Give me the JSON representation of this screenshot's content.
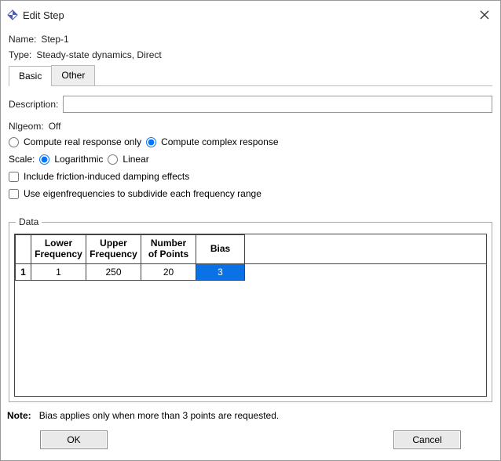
{
  "window": {
    "title": "Edit Step"
  },
  "name": {
    "label": "Name:",
    "value": "Step-1"
  },
  "type": {
    "label": "Type:",
    "value": "Steady-state dynamics, Direct"
  },
  "tabs": {
    "basic": "Basic",
    "other": "Other"
  },
  "description": {
    "label": "Description:",
    "value": ""
  },
  "nlgeom": {
    "label": "Nlgeom:",
    "value": "Off"
  },
  "response": {
    "real": "Compute real response only",
    "complex": "Compute complex response"
  },
  "scale": {
    "label": "Scale:",
    "log": "Logarithmic",
    "lin": "Linear"
  },
  "checks": {
    "friction": "Include friction-induced damping effects",
    "eigen": "Use eigenfrequencies to subdivide each frequency range"
  },
  "data": {
    "legend": "Data",
    "headers": {
      "lower": "Lower\nFrequency",
      "upper": "Upper\nFrequency",
      "points": "Number\nof Points",
      "bias": "Bias"
    },
    "rows": [
      {
        "idx": "1",
        "lower": "1",
        "upper": "250",
        "points": "20",
        "bias": "3"
      }
    ]
  },
  "note": {
    "label": "Note:",
    "text": "Bias applies only when more than 3 points are requested."
  },
  "buttons": {
    "ok": "OK",
    "cancel": "Cancel"
  }
}
